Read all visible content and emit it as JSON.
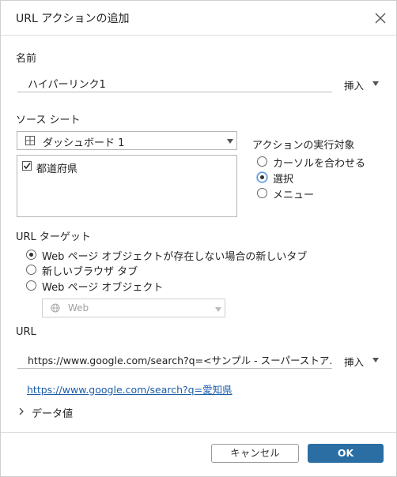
{
  "dialog": {
    "title": "URL アクションの追加"
  },
  "name_section": {
    "label": "名前",
    "value": "ハイパーリンク1",
    "insert_label": "挿入"
  },
  "source": {
    "label": "ソース シート",
    "selected": "ダッシュボード 1",
    "sheets": [
      {
        "label": "都道府県",
        "checked": true
      }
    ]
  },
  "run_on": {
    "label": "アクションの実行対象",
    "options": [
      {
        "label": "カーソルを合わせる",
        "selected": false
      },
      {
        "label": "選択",
        "selected": true
      },
      {
        "label": "メニュー",
        "selected": false
      }
    ]
  },
  "url_target": {
    "label": "URL ターゲット",
    "options": [
      {
        "label": "Web ページ オブジェクトが存在しない場合の新しいタブ",
        "selected": true
      },
      {
        "label": "新しいブラウザ タブ",
        "selected": false
      },
      {
        "label": "Web ページ オブジェクト",
        "selected": false
      }
    ],
    "object_select": "Web"
  },
  "url": {
    "label": "URL",
    "value": "https://www.google.com/search?q=<サンプル - スーパーストア.都道府県>",
    "insert_label": "挿入",
    "preview_link": "https://www.google.com/search?q=愛知県"
  },
  "data_values": {
    "label": "データ値"
  },
  "buttons": {
    "cancel": "キャンセル",
    "ok": "OK"
  },
  "colors": {
    "ok_button": "#2a6ea4",
    "link": "#1b5da8",
    "focus_ring": "#4a90d9"
  }
}
